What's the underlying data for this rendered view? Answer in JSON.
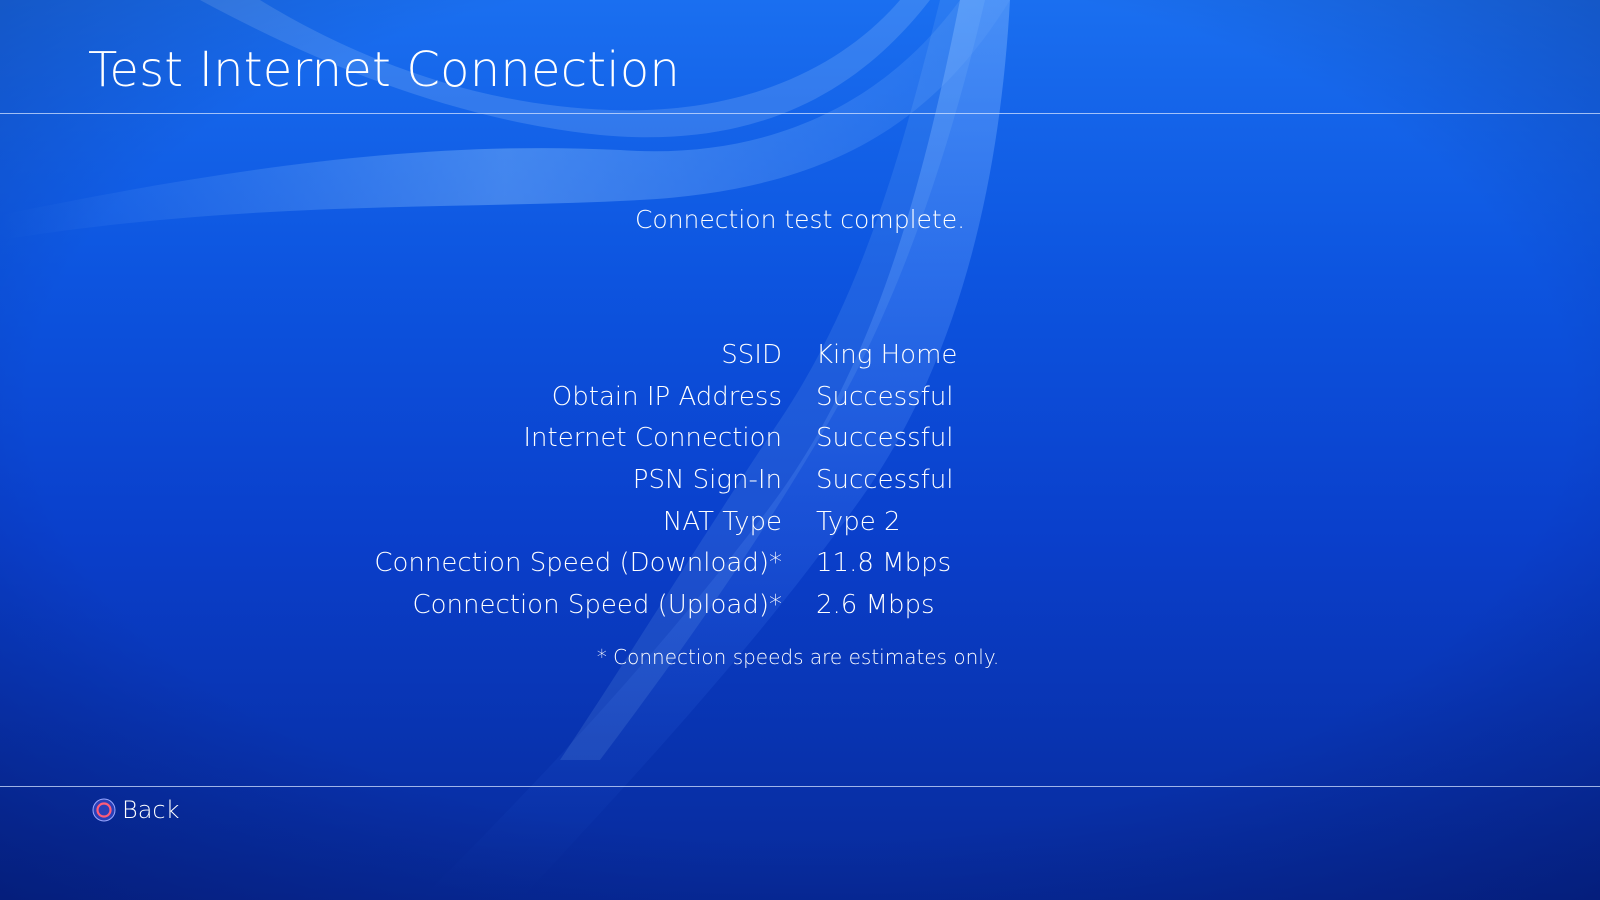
{
  "header": {
    "title": "Test Internet Connection"
  },
  "status": {
    "message": "Connection test complete."
  },
  "results": [
    {
      "label": "SSID",
      "value": "King Home"
    },
    {
      "label": "Obtain IP Address",
      "value": "Successful"
    },
    {
      "label": "Internet Connection",
      "value": "Successful"
    },
    {
      "label": "PSN Sign-In",
      "value": "Successful"
    },
    {
      "label": "NAT Type",
      "value": "Type 2"
    },
    {
      "label": "Connection Speed (Download)*",
      "value": "11.8 Mbps"
    },
    {
      "label": "Connection Speed (Upload)*",
      "value": "2.6 Mbps"
    }
  ],
  "footnote": "* Connection speeds are estimates only.",
  "footer": {
    "back_label": "Back",
    "back_icon": "circle-button-icon"
  },
  "colors": {
    "background_top": "#1a6ff0",
    "background_bottom": "#072a9a",
    "text": "#ffffff",
    "circle_button": "#e8506a"
  }
}
